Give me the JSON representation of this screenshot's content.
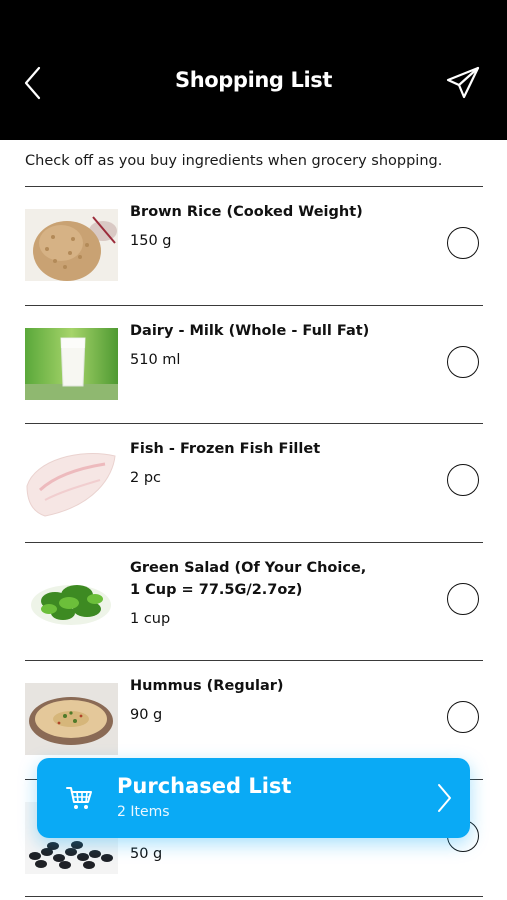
{
  "header": {
    "title": "Shopping List",
    "back_icon": "chevron-left-icon",
    "send_icon": "paper-plane-icon",
    "background": "#000000"
  },
  "subtitle": "Check off as you buy ingredients when grocery shopping.",
  "items": [
    {
      "name": "Brown Rice (Cooked Weight)",
      "quantity": "150 g",
      "checked": false
    },
    {
      "name": "Dairy - Milk (Whole - Full Fat)",
      "quantity": "510 ml",
      "checked": false
    },
    {
      "name": "Fish - Frozen Fish Fillet",
      "quantity": "2 pc",
      "checked": false
    },
    {
      "name": "Green Salad (Of Your Choice, 1 Cup = 77.5G/2.7oz)",
      "quantity": "1 cup",
      "checked": false
    },
    {
      "name": "Hummus (Regular)",
      "quantity": "90 g",
      "checked": false
    },
    {
      "name": "",
      "quantity": "50 g",
      "checked": false
    }
  ],
  "purchased_list": {
    "title": "Purchased List",
    "count": "2 Items",
    "accent": "#0aaaf5"
  }
}
